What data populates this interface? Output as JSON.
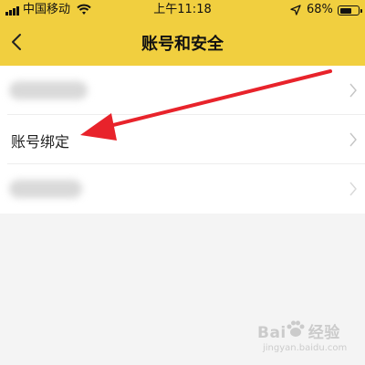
{
  "status_bar": {
    "carrier": "中国移动",
    "time": "上午11:18",
    "battery": "68%",
    "battery_level": 0.68
  },
  "nav": {
    "title": "账号和安全"
  },
  "list": {
    "items": [
      {
        "label": "",
        "blurred": true
      },
      {
        "label": "账号绑定",
        "blurred": false
      },
      {
        "label": "",
        "blurred": true
      }
    ]
  },
  "annotation": {
    "arrow_color": "#e8232b"
  },
  "colors": {
    "header": "#f1cf3f",
    "background": "#f4f4f4"
  },
  "icons": [
    "signal-icon",
    "wifi-icon",
    "location-icon",
    "battery-icon",
    "back-icon",
    "chevron-right-icon",
    "annotation-arrow"
  ],
  "watermark": {
    "brand_left": "Bai",
    "brand_right": "经验",
    "url": "jingyan.baidu.com"
  }
}
